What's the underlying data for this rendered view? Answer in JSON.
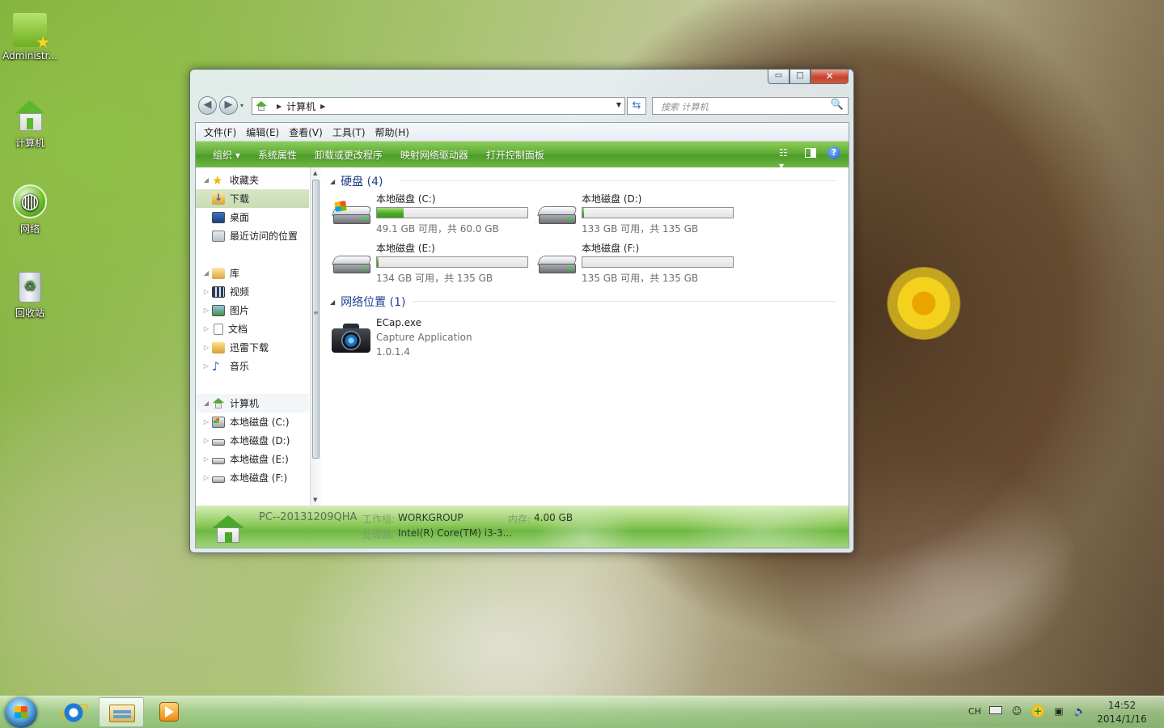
{
  "desktop": {
    "icons": [
      {
        "label": "Administr..."
      },
      {
        "label": "计算机"
      },
      {
        "label": "网络"
      },
      {
        "label": "回收站"
      }
    ]
  },
  "window": {
    "caption": {
      "minimize": "▭",
      "maximize": "□",
      "close": "✕"
    },
    "nav": {
      "back": "◀",
      "forward": "▶",
      "recent": "▾",
      "refresh": "⇆",
      "sep": "▶",
      "dropdown": "▼"
    },
    "address": {
      "segments": [
        "计算机"
      ]
    },
    "search": {
      "placeholder": "搜索 计算机",
      "icon": "🔍"
    },
    "menu": [
      "文件(F)",
      "编辑(E)",
      "查看(V)",
      "工具(T)",
      "帮助(H)"
    ],
    "toolbar": {
      "items": [
        "组织 ▾",
        "系统属性",
        "卸载或更改程序",
        "映射网络驱动器",
        "打开控制面板"
      ],
      "view_icon": "☷ ▾",
      "help": "?"
    },
    "navpane": {
      "favorites": {
        "title": "收藏夹",
        "items": [
          "下载",
          "桌面",
          "最近访问的位置"
        ]
      },
      "libraries": {
        "title": "库",
        "items": [
          "视频",
          "图片",
          "文档",
          "迅雷下载",
          "音乐"
        ]
      },
      "computer": {
        "title": "计算机",
        "items": [
          "本地磁盘 (C:)",
          "本地磁盘 (D:)",
          "本地磁盘 (E:)",
          "本地磁盘 (F:)"
        ]
      }
    },
    "scroll": {
      "up": "▲",
      "down": "▼",
      "grip": "≡"
    },
    "content": {
      "disks": {
        "title": "硬盘 (4)",
        "drives": [
          {
            "name": "本地磁盘 (C:)",
            "free": "49.1 GB 可用，共 60.0 GB",
            "used_fraction": 0.18
          },
          {
            "name": "本地磁盘 (D:)",
            "free": "133 GB 可用，共 135 GB",
            "used_fraction": 0.01
          },
          {
            "name": "本地磁盘 (E:)",
            "free": "134 GB 可用，共 135 GB",
            "used_fraction": 0.01
          },
          {
            "name": "本地磁盘 (F:)",
            "free": "135 GB 可用，共 135 GB",
            "used_fraction": 0.0
          }
        ]
      },
      "network": {
        "title": "网络位置 (1)",
        "item": {
          "name": "ECap.exe",
          "desc": "Capture Application",
          "version": "1.0.1.4"
        }
      }
    },
    "details": {
      "pc_name": "PC--20131209QHA",
      "workgroup_label": "工作组:",
      "workgroup": "WORKGROUP",
      "memory_label": "内存:",
      "memory": "4.00 GB",
      "cpu_label": "处理器:",
      "cpu": "Intel(R) Core(TM) i3-3..."
    }
  },
  "taskbar": {
    "tray": {
      "lang": "CH"
    },
    "clock": {
      "time": "14:52",
      "date": "2014/1/16"
    }
  },
  "colors": {
    "accent_green": "#5aa832",
    "link_blue": "#1e3f8f",
    "close_red": "#c6412b"
  }
}
